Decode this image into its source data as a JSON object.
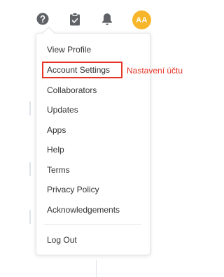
{
  "header": {
    "avatar_initials": "AA"
  },
  "menu": {
    "items": [
      {
        "label": "View Profile"
      },
      {
        "label": "Account Settings"
      },
      {
        "label": "Collaborators"
      },
      {
        "label": "Updates"
      },
      {
        "label": "Apps"
      },
      {
        "label": "Help"
      },
      {
        "label": "Terms"
      },
      {
        "label": "Privacy Policy"
      },
      {
        "label": "Acknowledgements"
      }
    ],
    "logout_label": "Log Out"
  },
  "annotation": {
    "text": "Nastavení účtu",
    "color": "#e53325"
  },
  "colors": {
    "icon": "#5f6368",
    "avatar_bg": "#f7b62a"
  }
}
